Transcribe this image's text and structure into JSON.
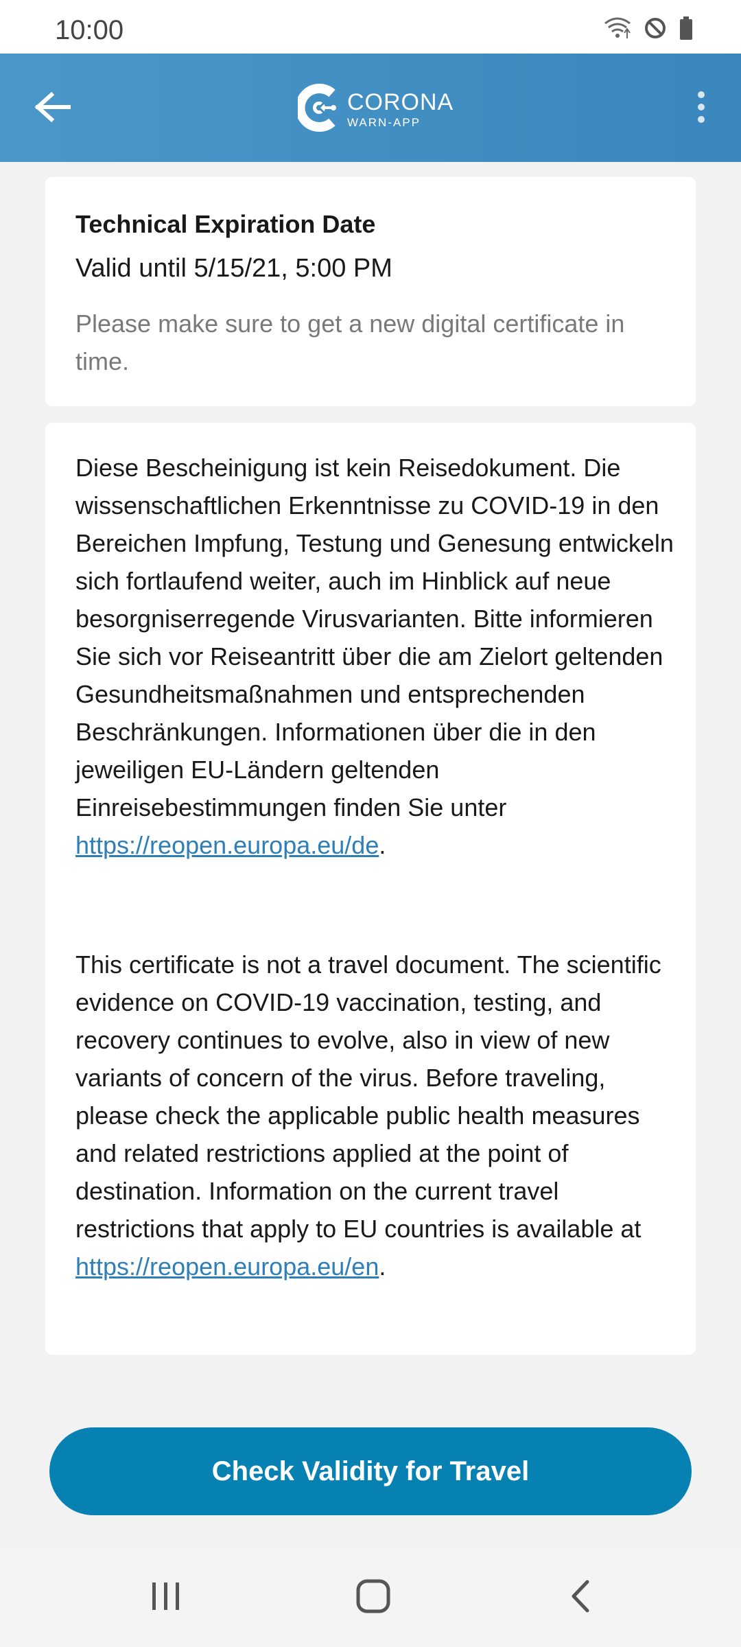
{
  "status_bar": {
    "time": "10:00",
    "icons": [
      "wifi-icon",
      "do-not-disturb-icon",
      "battery-icon"
    ]
  },
  "app_bar": {
    "logo_title": "CORONA",
    "logo_subtitle": "WARN-APP",
    "back_icon": "arrow-left-icon",
    "menu_icon": "more-vertical-icon"
  },
  "expiry_card": {
    "title": "Technical Expiration Date",
    "valid_until": "Valid until 5/15/21, 5:00 PM",
    "note": "Please make sure to get a new digital certificate in time."
  },
  "info_card": {
    "de_text": "Diese Bescheinigung ist kein Reisedokument. Die wissenschaftlichen Erkenntnisse zu COVID-19 in den Bereichen Impfung, Testung und Genesung entwickeln sich fortlaufend weiter, auch im Hinblick auf neue besorgniserregende Virusvarianten. Bitte informieren Sie sich vor Reiseantritt über die am Zielort geltenden Gesundheitsmaßnahmen und entsprechenden Beschränkungen. Informationen über die in den jeweiligen EU-Ländern geltenden Einreisebestimmungen finden Sie unter ",
    "de_link": "https://reopen.europa.eu/de",
    "de_suffix": ".",
    "en_text": "This certificate is not a travel document. The scientific evidence on COVID-19 vaccination, testing, and recovery continues to evolve, also in view of new variants of concern of the virus. Before traveling, please check the applicable public health measures and related restrictions applied at the point of destination. Information on the current travel restrictions that apply to EU countries is available at ",
    "en_link": "https://reopen.europa.eu/en",
    "en_suffix": "."
  },
  "actions": {
    "check_validity_label": "Check Validity for Travel"
  },
  "nav_bar": {
    "items": [
      "recent-apps-icon",
      "home-icon",
      "back-icon"
    ]
  },
  "colors": {
    "app_bar": "#3a87be",
    "primary_button": "#0780b2",
    "link": "#2e7fb8",
    "background": "#f2f2f2"
  }
}
